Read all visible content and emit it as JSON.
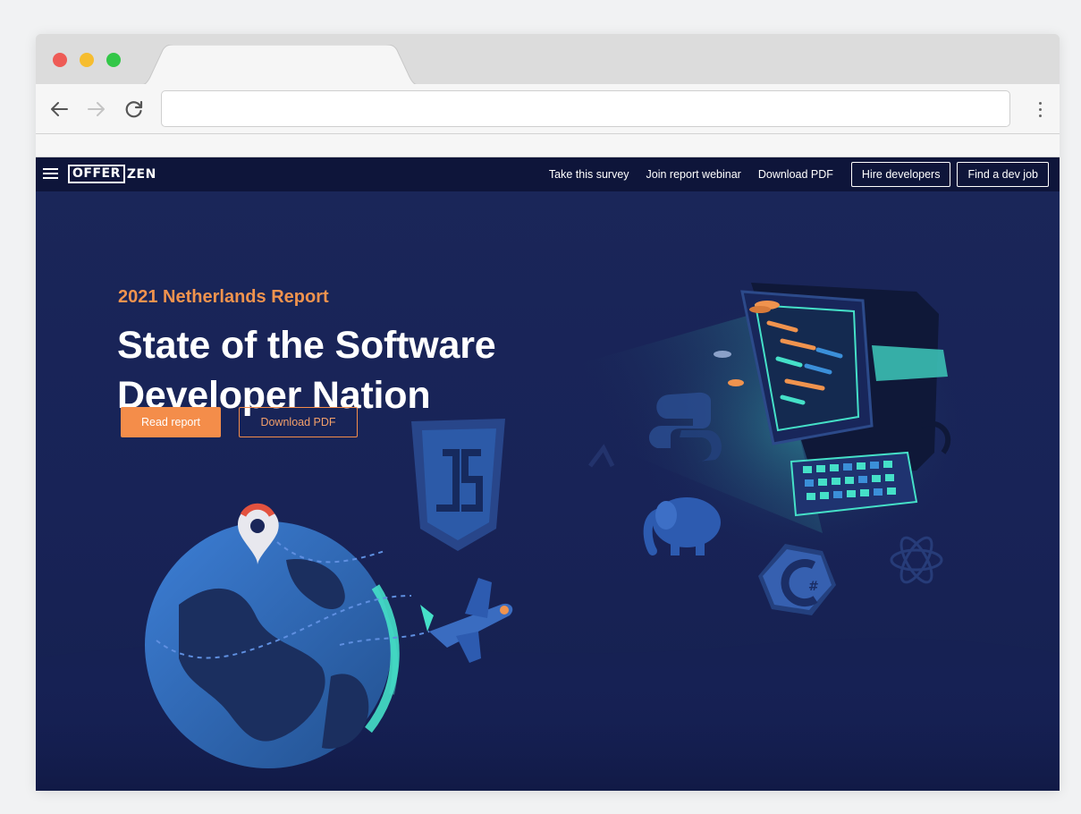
{
  "browser": {
    "url": "",
    "icons": [
      "back-arrow-icon",
      "forward-arrow-icon",
      "reload-icon",
      "more-menu-icon"
    ]
  },
  "site": {
    "logo_boxed": "OFFER",
    "logo_rest": "ZEN",
    "nav": {
      "survey": "Take this survey",
      "webinar": "Join report webinar",
      "download": "Download PDF",
      "hire": "Hire developers",
      "job": "Find a dev job"
    }
  },
  "hero": {
    "subtitle": "2021 Netherlands Report",
    "title": "State of the Software Developer Nation",
    "primary_button": "Read report",
    "secondary_button": "Download PDF"
  },
  "colors": {
    "page_bg": "#1a2659",
    "nav_bg": "#0e153a",
    "accent_orange": "#f48d4a",
    "teal_glow": "#45e0c8"
  }
}
